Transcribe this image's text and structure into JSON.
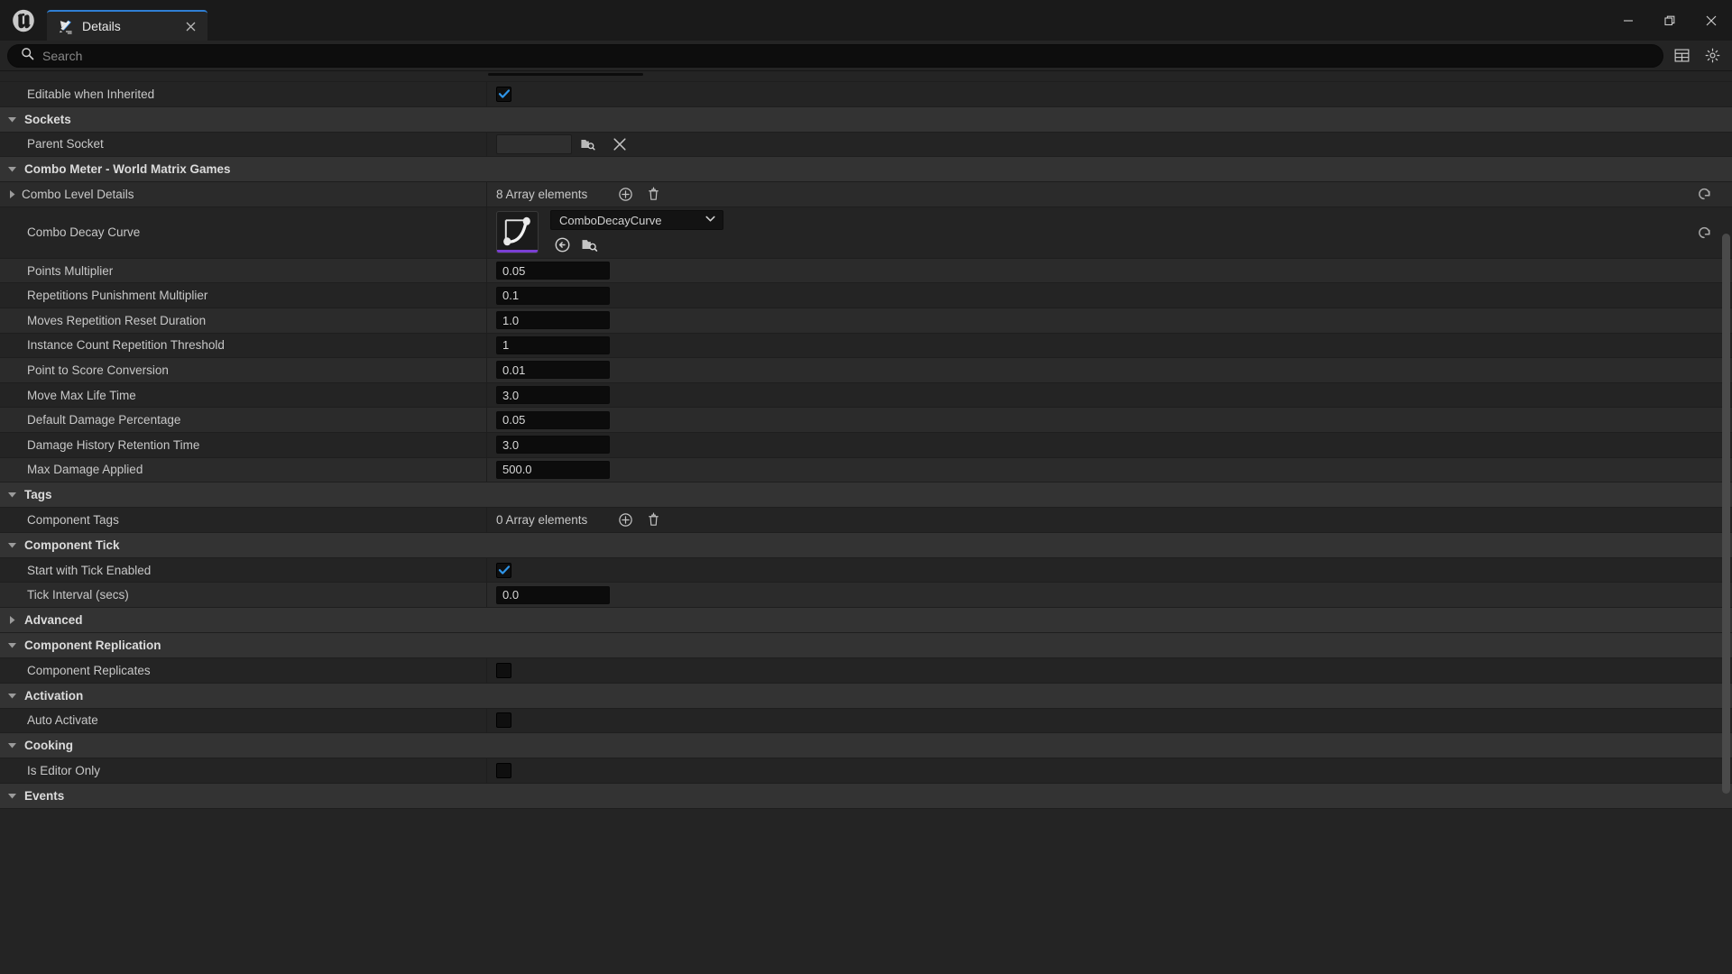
{
  "window": {
    "tab_label": "Details",
    "tab_icon": "details-panel-icon",
    "logo_icon": "unreal-engine-logo",
    "close_tab_icon": "close-icon",
    "minimize_label": "minimize-icon",
    "maximize_label": "restore-icon",
    "close_label": "close-icon",
    "accent_color": "#2f7fd4"
  },
  "search": {
    "placeholder": "Search",
    "value": "",
    "icon": "search-icon",
    "column_view_icon": "column-view-icon",
    "settings_icon": "gear-icon"
  },
  "rows": [
    {
      "type": "property",
      "label": "Editable when Inherited",
      "control": "checkbox",
      "checked": true,
      "shade": "norm"
    },
    {
      "type": "category",
      "label": "Sockets",
      "expanded": true
    },
    {
      "type": "property",
      "label": "Parent Socket",
      "control": "socket",
      "shade": "norm",
      "browse_icon": "browse-asset-icon",
      "clear_icon": "clear-icon"
    },
    {
      "type": "category",
      "label": "Combo Meter - World Matrix Games",
      "expanded": true
    },
    {
      "type": "property",
      "label": "Combo Level Details",
      "control": "array",
      "array_text": "8 Array elements",
      "collapsed_arrow": true,
      "shade": "alt",
      "reset": true,
      "add_icon": "add-element-icon",
      "delete_icon": "delete-icon"
    },
    {
      "type": "property",
      "label": "Combo Decay Curve",
      "control": "curve",
      "asset_name": "ComboDecayCurve",
      "shade": "norm",
      "reset": true,
      "tall": true,
      "thumbnail_icon": "curve-thumbnail-icon",
      "browse_back_icon": "use-selected-asset-icon",
      "browse_icon": "browse-to-asset-icon",
      "dropdown_icon": "chevron-down-icon"
    },
    {
      "type": "property",
      "label": "Points Multiplier",
      "control": "number",
      "value": "0.05",
      "shade": "alt"
    },
    {
      "type": "property",
      "label": "Repetitions Punishment Multiplier",
      "control": "number",
      "value": "0.1",
      "shade": "norm"
    },
    {
      "type": "property",
      "label": "Moves Repetition Reset Duration",
      "control": "number",
      "value": "1.0",
      "shade": "alt"
    },
    {
      "type": "property",
      "label": "Instance Count Repetition Threshold",
      "control": "number",
      "value": "1",
      "shade": "norm"
    },
    {
      "type": "property",
      "label": "Point to Score Conversion",
      "control": "number",
      "value": "0.01",
      "shade": "alt"
    },
    {
      "type": "property",
      "label": "Move Max Life Time",
      "control": "number",
      "value": "3.0",
      "shade": "norm"
    },
    {
      "type": "property",
      "label": "Default Damage Percentage",
      "control": "number",
      "value": "0.05",
      "shade": "alt"
    },
    {
      "type": "property",
      "label": "Damage History Retention Time",
      "control": "number",
      "value": "3.0",
      "shade": "norm"
    },
    {
      "type": "property",
      "label": "Max Damage Applied",
      "control": "number",
      "value": "500.0",
      "shade": "alt"
    },
    {
      "type": "category",
      "label": "Tags",
      "expanded": true
    },
    {
      "type": "property",
      "label": "Component Tags",
      "control": "array",
      "array_text": "0 Array elements",
      "shade": "norm",
      "add_icon": "add-element-icon",
      "delete_icon": "delete-icon"
    },
    {
      "type": "category",
      "label": "Component Tick",
      "expanded": true
    },
    {
      "type": "property",
      "label": "Start with Tick Enabled",
      "control": "checkbox",
      "checked": true,
      "shade": "norm"
    },
    {
      "type": "property",
      "label": "Tick Interval (secs)",
      "control": "number",
      "value": "0.0",
      "shade": "alt"
    },
    {
      "type": "category",
      "label": "Advanced",
      "expanded": false,
      "sub": true
    },
    {
      "type": "category",
      "label": "Component Replication",
      "expanded": true
    },
    {
      "type": "property",
      "label": "Component Replicates",
      "control": "checkbox",
      "checked": false,
      "shade": "norm"
    },
    {
      "type": "category",
      "label": "Activation",
      "expanded": true
    },
    {
      "type": "property",
      "label": "Auto Activate",
      "control": "checkbox",
      "checked": false,
      "shade": "norm"
    },
    {
      "type": "category",
      "label": "Cooking",
      "expanded": true
    },
    {
      "type": "property",
      "label": "Is Editor Only",
      "control": "checkbox",
      "checked": false,
      "shade": "norm"
    },
    {
      "type": "category",
      "label": "Events",
      "expanded": true
    }
  ],
  "scrollbar": {
    "name": "vertical-scrollbar",
    "thumb_top_pct": 18,
    "thumb_height_pct": 62
  }
}
